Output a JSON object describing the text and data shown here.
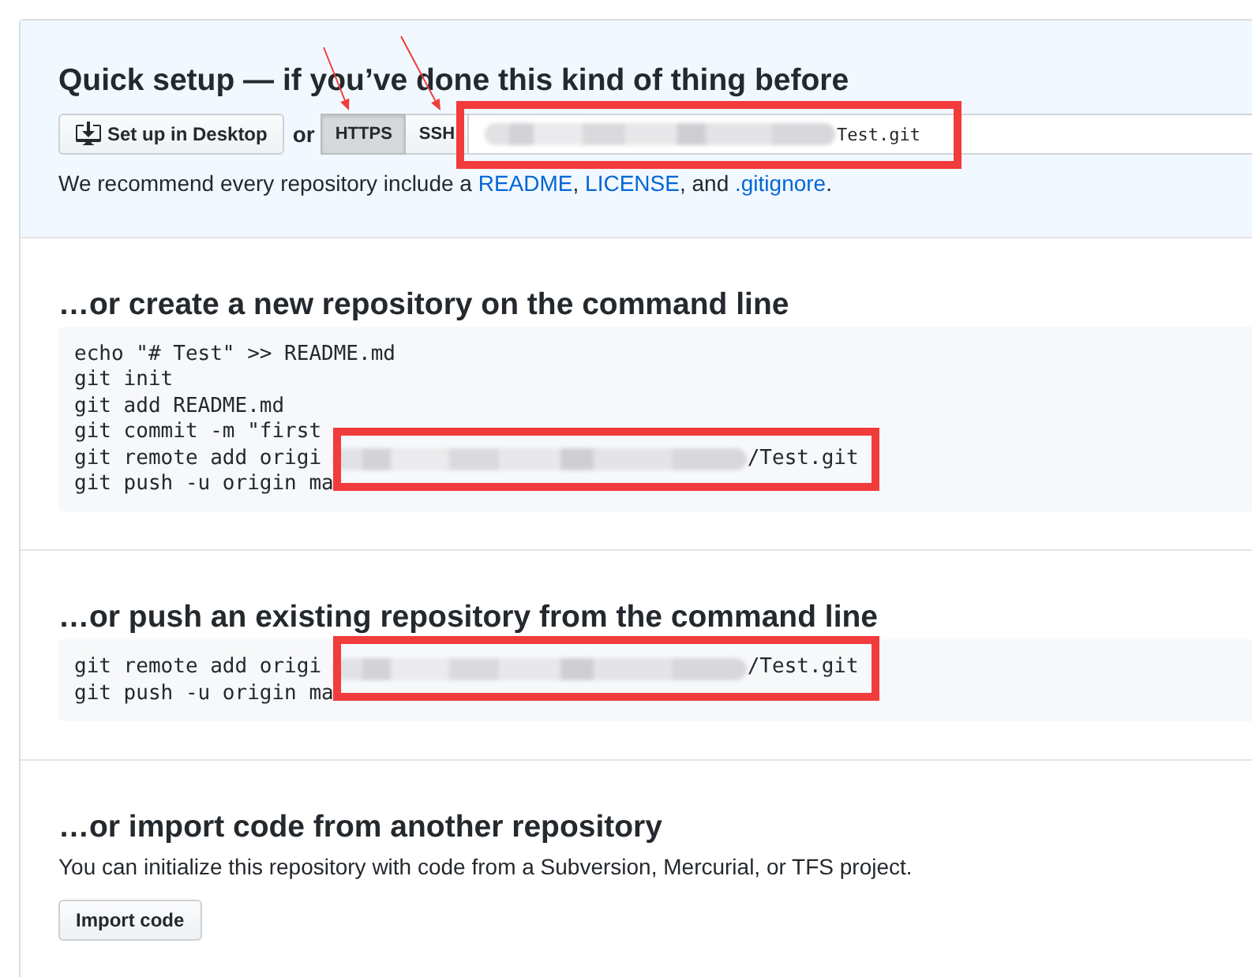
{
  "quick_setup": {
    "title": "Quick setup — if you’ve done this kind of thing before",
    "desktop_button": "Set up in Desktop",
    "or_label": "or",
    "protocols": [
      {
        "label": "HTTPS",
        "selected": true,
        "arrow_annotation": true
      },
      {
        "label": "SSH",
        "selected": false,
        "arrow_annotation": true
      }
    ],
    "clone_url": {
      "redacted": true,
      "value": "Test.git",
      "highlighted": true
    },
    "recommendation": {
      "lead": "We recommend every repository include a ",
      "links": [
        {
          "text": "README",
          "after": ", "
        },
        {
          "text": "LICENSE",
          "after": ", and "
        },
        {
          "text": ".gitignore",
          "after": "."
        }
      ]
    }
  },
  "sections": [
    {
      "kind": "commands",
      "title": "…or create a new repository on the command line",
      "lines": [
        {
          "text": "echo \"# Test\" >> README.md",
          "redacted": false,
          "highlighted": false
        },
        {
          "text": "git init",
          "redacted": false,
          "highlighted": false
        },
        {
          "text": "git add README.md",
          "redacted": false,
          "highlighted": false
        },
        {
          "text": "git commit -m \"first",
          "redacted": false,
          "highlighted": false
        },
        {
          "text": "git remote add origi",
          "redacted": true,
          "tail": "/Test.git",
          "highlighted": true
        },
        {
          "text": "git push -u origin ma",
          "redacted": false,
          "highlighted": false
        }
      ]
    },
    {
      "kind": "commands",
      "title": "…or push an existing repository from the command line",
      "lines": [
        {
          "text": "git remote add origi",
          "redacted": true,
          "tail": "/Test.git",
          "highlighted": true
        },
        {
          "text": "git push -u origin ma",
          "redacted": false,
          "highlighted": false
        }
      ]
    },
    {
      "kind": "import",
      "title": "…or import code from another repository",
      "description": "You can initialize this repository with code from a Subversion, Mercurial, or TFS project.",
      "button": "Import code"
    }
  ]
}
